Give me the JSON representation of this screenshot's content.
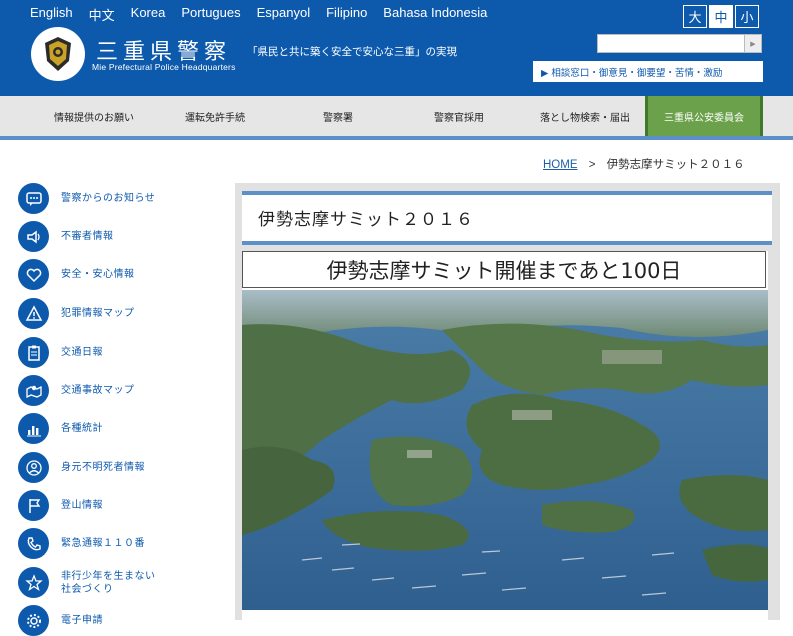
{
  "header": {
    "languages": [
      "English",
      "中文",
      "Korea",
      "Portugues",
      "Espanyol",
      "Filipino",
      "Bahasa Indonesia"
    ],
    "site_title": "三重県警察",
    "site_subtitle": "Mie Prefectural Police Headquarters",
    "slogan": "「県民と共に築く安全で安心な三重」の実現",
    "font_sizes": [
      "大",
      "中",
      "小"
    ],
    "search_placeholder": "",
    "contact_button": "▶ 相談窓口・御意見・御要望・苦情・激励",
    "brand_color": "#0d5aad"
  },
  "nav": {
    "items": [
      "情報提供のお願い",
      "運転免許手続",
      "警察署",
      "警察官採用",
      "落とし物検索・届出",
      "三重県公安委員会"
    ]
  },
  "breadcrumb": {
    "home": "HOME",
    "separator": ">",
    "current": "伊勢志摩サミット２０１６"
  },
  "sidebar": {
    "items": [
      {
        "label": "警察からのお知らせ",
        "icon": "speech-bubble-icon"
      },
      {
        "label": "不審者情報",
        "icon": "megaphone-icon"
      },
      {
        "label": "安全・安心情報",
        "icon": "heart-icon"
      },
      {
        "label": "犯罪情報マップ",
        "icon": "warning-icon"
      },
      {
        "label": "交通日報",
        "icon": "clipboard-icon"
      },
      {
        "label": "交通事故マップ",
        "icon": "map-pin-icon"
      },
      {
        "label": "各種統計",
        "icon": "bar-chart-icon"
      },
      {
        "label": "身元不明死者情報",
        "icon": "person-icon"
      },
      {
        "label": "登山情報",
        "icon": "flag-icon"
      },
      {
        "label": "緊急通報１１０番",
        "icon": "phone-icon"
      },
      {
        "label": "非行少年を生まない\n社会づくり",
        "icon": "star-icon"
      },
      {
        "label": "電子申請",
        "icon": "gear-icon"
      }
    ]
  },
  "main": {
    "page_title": "伊勢志摩サミット２０１６",
    "headline": "伊勢志摩サミット開催まであと100日",
    "photo_icon": "aerial-bay-photo"
  }
}
